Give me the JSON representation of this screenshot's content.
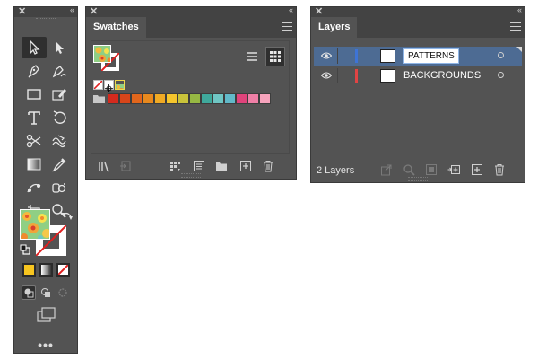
{
  "tools_panel": {
    "close": "✕",
    "collapse": "‹‹",
    "more": "•••"
  },
  "swatches_panel": {
    "close": "✕",
    "collapse": "‹‹",
    "tab_title": "Swatches",
    "swatch_colors": [
      "#d42a1e",
      "#d8451a",
      "#e1661c",
      "#e8891e",
      "#f0aa24",
      "#f5c52c",
      "#c9c33a",
      "#96b843",
      "#3fa99c",
      "#6fc6c4",
      "#61b9c9",
      "#e0437b",
      "#ef7fa6",
      "#f6a3bc"
    ]
  },
  "layers_panel": {
    "close": "✕",
    "collapse": "‹‹",
    "tab_title": "Layers",
    "layers": [
      {
        "name": "PATTERNS",
        "color": "#3e74d6",
        "editing": true
      },
      {
        "name": "BACKGROUNDS",
        "color": "#e14444",
        "editing": false
      }
    ],
    "layer_count": "2 Layers"
  },
  "colors": {
    "panel_bg": "#535353",
    "selection_blue": "#4d6b93",
    "fill_yellow": "#f7c51f"
  }
}
